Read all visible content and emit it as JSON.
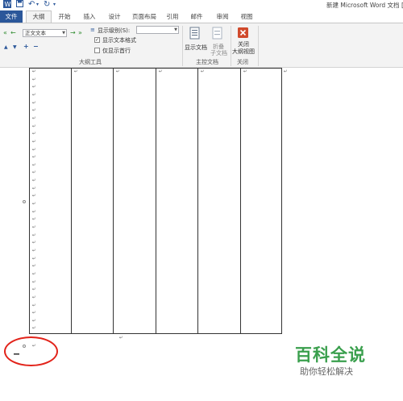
{
  "window": {
    "title": "新建 Microsoft Word 文档 ["
  },
  "quick_access": {
    "undo_glyph": "↶",
    "redo_glyph": "↻",
    "customize_glyph": "▾"
  },
  "tabs": [
    {
      "label": "文件",
      "kind": "file"
    },
    {
      "label": "大纲",
      "kind": "active"
    },
    {
      "label": "开始"
    },
    {
      "label": "插入"
    },
    {
      "label": "设计"
    },
    {
      "label": "页面布局"
    },
    {
      "label": "引用"
    },
    {
      "label": "邮件"
    },
    {
      "label": "审阅"
    },
    {
      "label": "视图"
    }
  ],
  "ribbon": {
    "outline_tools": {
      "level_value": "正文文本",
      "show_level_label": "显示级别(S):",
      "show_level_value": "",
      "show_text_format_label": "显示文本格式",
      "show_text_format_checked": true,
      "first_line_only_label": "仅显示首行",
      "first_line_only_checked": false,
      "group_label": "大纲工具",
      "icons": {
        "promote_to_heading1": "«",
        "promote": "←",
        "demote": "→",
        "demote_to_body": "»",
        "move_up": "▲",
        "move_down": "▼",
        "expand": "+",
        "collapse": "−"
      }
    },
    "master_document": {
      "show_document_label": "显示文档",
      "collapse_subdocs_line1": "折叠",
      "collapse_subdocs_line2": "子文档",
      "group_label": "主控文档"
    },
    "close": {
      "close_view_line1": "关闭",
      "close_view_line2": "大纲视图",
      "group_label": "关闭"
    }
  },
  "document": {
    "paragraph_mark": "↵",
    "cursor_mark": "_"
  },
  "watermark": {
    "main": "百科全说",
    "sub": "助你轻松解决"
  },
  "colors": {
    "accent": "#2b579a",
    "close_button": "#d04a2c",
    "annotation": "#e2231a",
    "watermark": "#3a9f4d"
  }
}
